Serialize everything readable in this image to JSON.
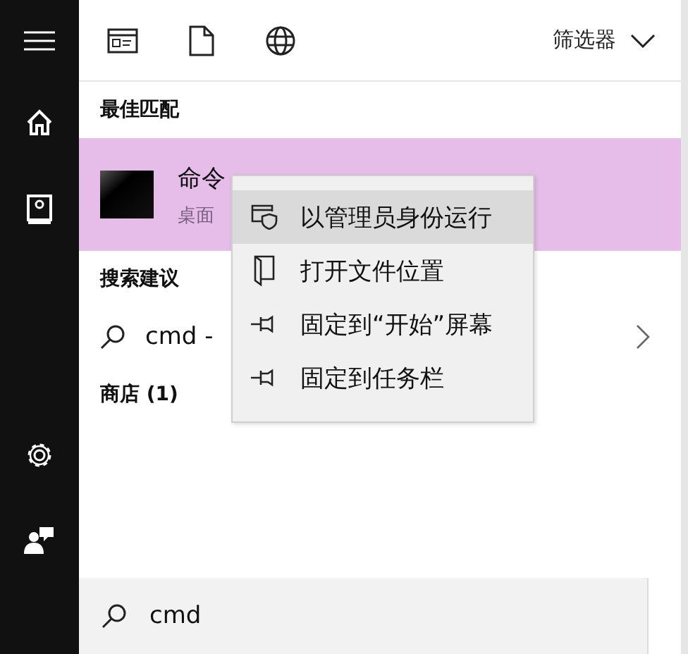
{
  "toolbar": {
    "filter_label": "筛选器"
  },
  "best_match": {
    "header": "最佳匹配",
    "item": {
      "title": "命令",
      "subtitle": "桌面",
      "selected": true
    }
  },
  "suggestions": {
    "header": "搜索建议",
    "items": [
      {
        "text": "cmd -"
      }
    ]
  },
  "store": {
    "header": "商店 (1)"
  },
  "context_menu": {
    "items": [
      {
        "label": "以管理员身份运行",
        "kind": "admin",
        "selected": true
      },
      {
        "label": "打开文件位置",
        "kind": "location",
        "selected": false
      },
      {
        "label": "固定到“开始”屏幕",
        "kind": "pin",
        "selected": false
      },
      {
        "label": "固定到任务栏",
        "kind": "pin",
        "selected": false
      }
    ]
  },
  "search": {
    "value": "cmd"
  }
}
